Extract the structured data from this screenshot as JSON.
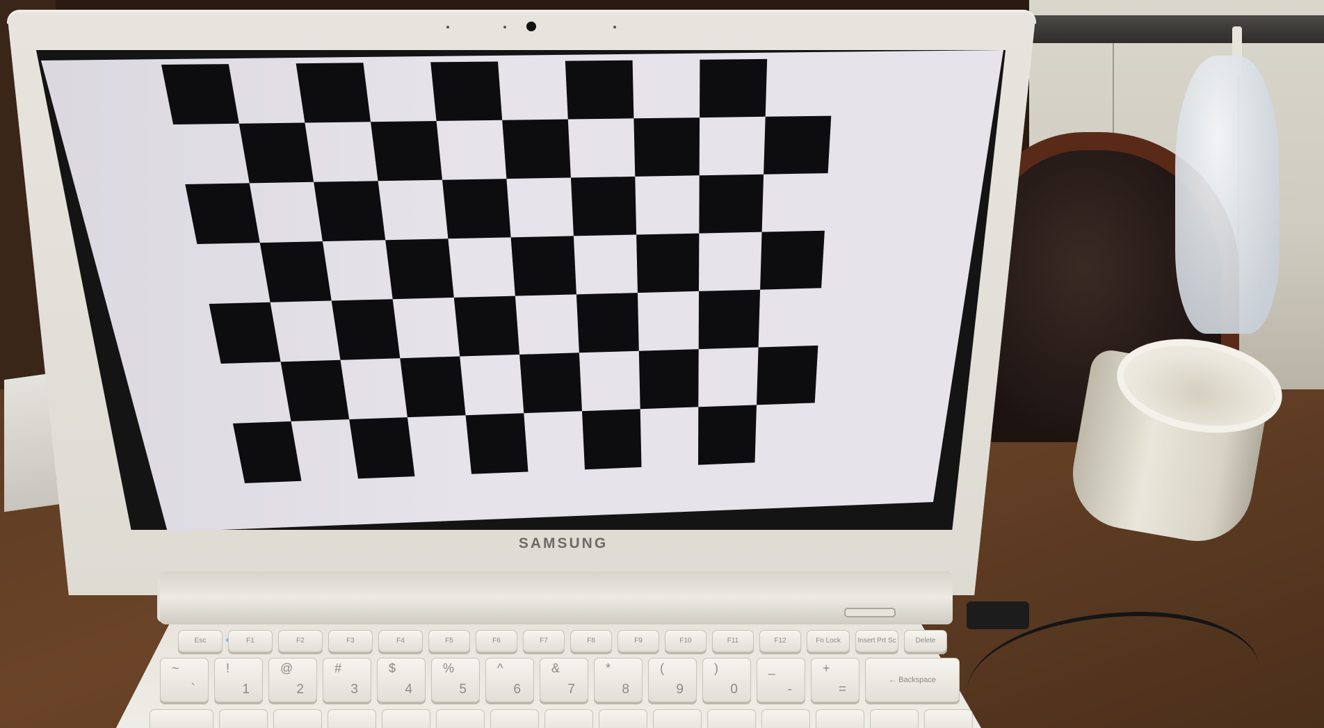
{
  "brand": {
    "logo_text": "SAMSUNG"
  },
  "chessboard": {
    "rows": 7,
    "cols": 10
  },
  "keyboard": {
    "function_row": [
      {
        "id": "esc",
        "label": "Esc"
      },
      {
        "id": "f1",
        "label": "F1"
      },
      {
        "id": "f2",
        "label": "F2"
      },
      {
        "id": "f3",
        "label": "F3"
      },
      {
        "id": "f4",
        "label": "F4"
      },
      {
        "id": "f5",
        "label": "F5"
      },
      {
        "id": "f6",
        "label": "F6"
      },
      {
        "id": "f7",
        "label": "F7"
      },
      {
        "id": "f8",
        "label": "F8"
      },
      {
        "id": "f9",
        "label": "F9"
      },
      {
        "id": "f10",
        "label": "F10"
      },
      {
        "id": "f11",
        "label": "F11"
      },
      {
        "id": "f12",
        "label": "F12"
      },
      {
        "id": "fn-lock",
        "label": "Fn Lock"
      },
      {
        "id": "insert",
        "label": "Insert Prt Sc"
      },
      {
        "id": "delete",
        "label": "Delete"
      }
    ],
    "number_row": [
      {
        "id": "tilde",
        "top": "~",
        "bottom": "`"
      },
      {
        "id": "1",
        "top": "!",
        "bottom": "1"
      },
      {
        "id": "2",
        "top": "@",
        "bottom": "2"
      },
      {
        "id": "3",
        "top": "#",
        "bottom": "3"
      },
      {
        "id": "4",
        "top": "$",
        "bottom": "4"
      },
      {
        "id": "5",
        "top": "%",
        "bottom": "5"
      },
      {
        "id": "6",
        "top": "^",
        "bottom": "6"
      },
      {
        "id": "7",
        "top": "&",
        "bottom": "7"
      },
      {
        "id": "8",
        "top": "*",
        "bottom": "8"
      },
      {
        "id": "9",
        "top": "(",
        "bottom": "9"
      },
      {
        "id": "0",
        "top": ")",
        "bottom": "0"
      },
      {
        "id": "minus",
        "top": "_",
        "bottom": "-"
      },
      {
        "id": "equals",
        "top": "+",
        "bottom": "="
      },
      {
        "id": "backspace",
        "top": "← Backspace",
        "bottom": ""
      }
    ]
  }
}
